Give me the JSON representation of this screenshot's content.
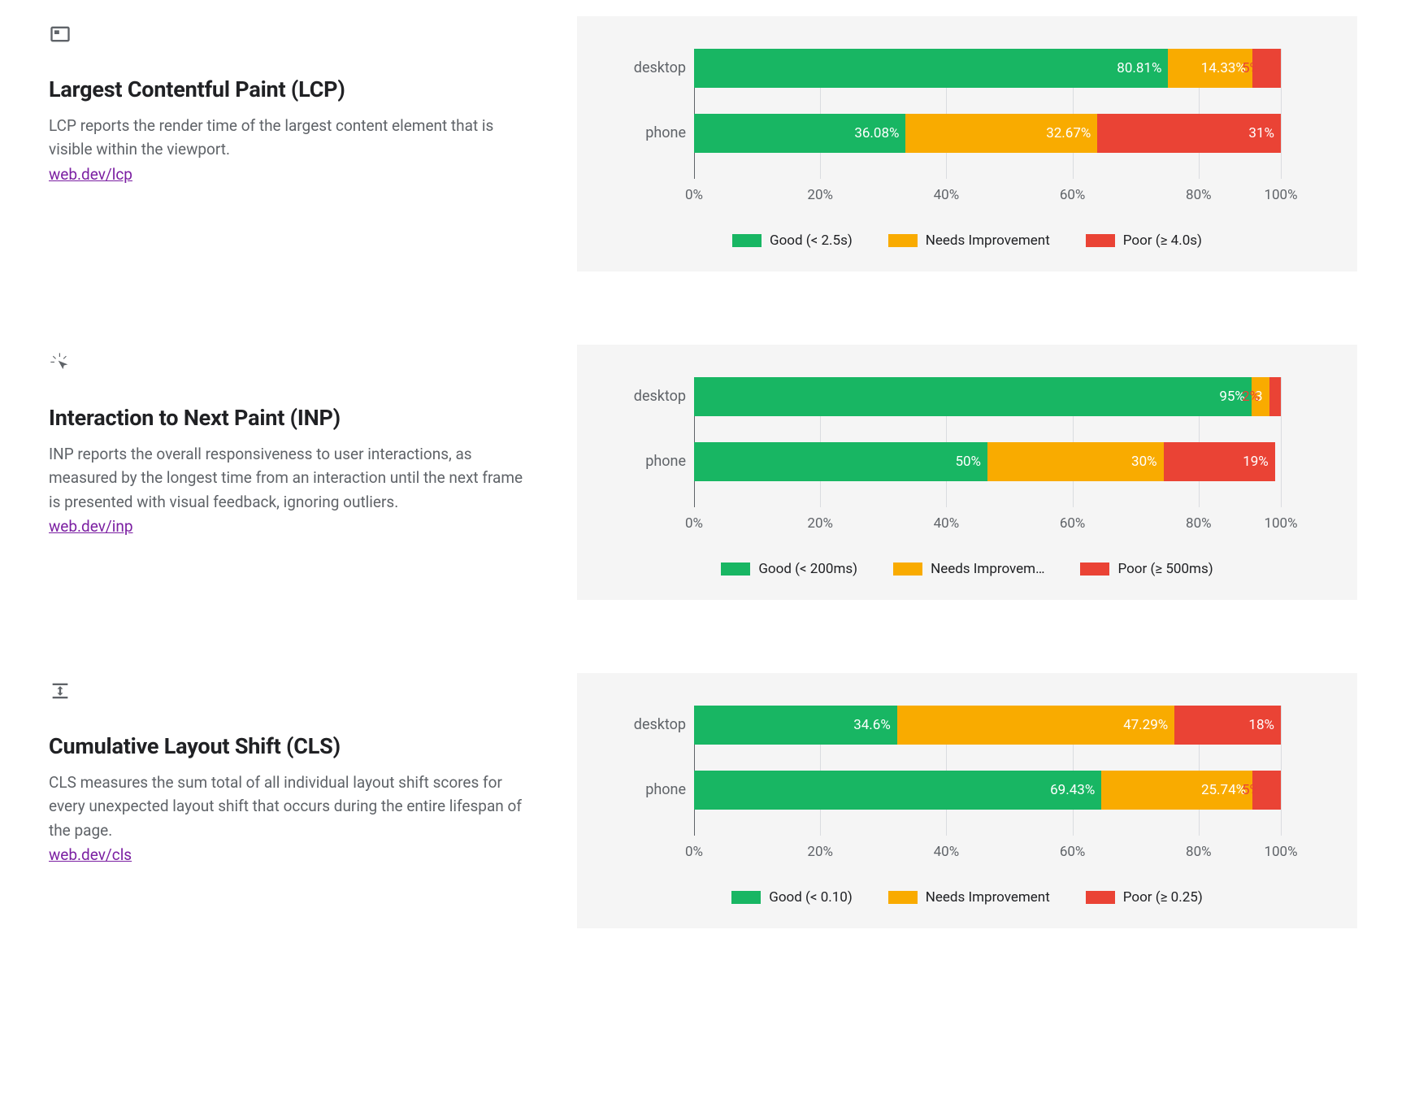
{
  "colors": {
    "good": "#18b663",
    "mid": "#f9ab00",
    "poor": "#ea4335"
  },
  "metrics": [
    {
      "key": "lcp",
      "title": "Largest Contentful Paint (LCP)",
      "desc": "LCP reports the render time of the largest content element that is visible within the viewport.",
      "link": "web.dev/lcp",
      "legend": {
        "good": "Good (< 2.5s)",
        "mid": "Needs Improvement",
        "poor": "Poor (≥ 4.0s)"
      },
      "rows": [
        {
          "label": "desktop",
          "good": {
            "value": 80.81,
            "text": "80.81%"
          },
          "mid": {
            "value": 14.33,
            "text": "14.33%"
          },
          "poor": {
            "value": 4.86,
            "text": ""
          },
          "trailing": "5%"
        },
        {
          "label": "phone",
          "good": {
            "value": 36.08,
            "text": "36.08%"
          },
          "mid": {
            "value": 32.67,
            "text": "32.67%"
          },
          "poor": {
            "value": 31.25,
            "text": "31%"
          },
          "trailing": ""
        }
      ]
    },
    {
      "key": "inp",
      "title": "Interaction to Next Paint (INP)",
      "desc": "INP reports the overall responsiveness to user interactions, as measured by the longest time from an interaction until the next frame is presented with visual feedback, ignoring outliers.",
      "link": "web.dev/inp",
      "legend": {
        "good": "Good (< 200ms)",
        "mid": "Needs Improvem…",
        "poor": "Poor (≥ 500ms)"
      },
      "rows": [
        {
          "label": "desktop",
          "good": {
            "value": 95.0,
            "text": "95%"
          },
          "mid": {
            "value": 3.0,
            "text": "3"
          },
          "poor": {
            "value": 2.0,
            "text": ""
          },
          "trailing": "2%"
        },
        {
          "label": "phone",
          "good": {
            "value": 50.0,
            "text": "50%"
          },
          "mid": {
            "value": 30.0,
            "text": "30%"
          },
          "poor": {
            "value": 19.0,
            "text": "19%"
          },
          "trailing": ""
        }
      ]
    },
    {
      "key": "cls",
      "title": "Cumulative Layout Shift (CLS)",
      "desc": "CLS measures the sum total of all individual layout shift scores for every unexpected layout shift that occurs during the entire lifespan of the page.",
      "link": "web.dev/cls",
      "legend": {
        "good": "Good (< 0.10)",
        "mid": "Needs Improvement",
        "poor": "Poor (≥ 0.25)"
      },
      "rows": [
        {
          "label": "desktop",
          "good": {
            "value": 34.6,
            "text": "34.6%"
          },
          "mid": {
            "value": 47.29,
            "text": "47.29%"
          },
          "poor": {
            "value": 18.11,
            "text": "18%"
          },
          "trailing": ""
        },
        {
          "label": "phone",
          "good": {
            "value": 69.43,
            "text": "69.43%"
          },
          "mid": {
            "value": 25.74,
            "text": "25.74%"
          },
          "poor": {
            "value": 4.83,
            "text": ""
          },
          "trailing": "5%"
        }
      ]
    }
  ],
  "ticks": [
    "0%",
    "20%",
    "40%",
    "60%",
    "80%",
    "100%"
  ],
  "chart_data": [
    {
      "type": "bar",
      "title": "Largest Contentful Paint (LCP)",
      "orientation": "horizontal-stacked",
      "xlabel": "",
      "ylabel": "",
      "xlim": [
        0,
        100
      ],
      "categories": [
        "desktop",
        "phone"
      ],
      "series": [
        {
          "name": "Good (< 2.5s)",
          "values": [
            80.81,
            36.08
          ]
        },
        {
          "name": "Needs Improvement",
          "values": [
            14.33,
            32.67
          ]
        },
        {
          "name": "Poor (≥ 4.0s)",
          "values": [
            4.86,
            31.25
          ]
        }
      ],
      "annotations": {
        "poor_outside_labels": [
          "5%",
          ""
        ]
      }
    },
    {
      "type": "bar",
      "title": "Interaction to Next Paint (INP)",
      "orientation": "horizontal-stacked",
      "xlabel": "",
      "ylabel": "",
      "xlim": [
        0,
        100
      ],
      "categories": [
        "desktop",
        "phone"
      ],
      "series": [
        {
          "name": "Good (< 200ms)",
          "values": [
            95,
            50
          ]
        },
        {
          "name": "Needs Improvement",
          "values": [
            3,
            30
          ]
        },
        {
          "name": "Poor (≥ 500ms)",
          "values": [
            2,
            19
          ]
        }
      ],
      "annotations": {
        "poor_outside_labels": [
          "2%",
          ""
        ]
      }
    },
    {
      "type": "bar",
      "title": "Cumulative Layout Shift (CLS)",
      "orientation": "horizontal-stacked",
      "xlabel": "",
      "ylabel": "",
      "xlim": [
        0,
        100
      ],
      "categories": [
        "desktop",
        "phone"
      ],
      "series": [
        {
          "name": "Good (< 0.10)",
          "values": [
            34.6,
            69.43
          ]
        },
        {
          "name": "Needs Improvement",
          "values": [
            47.29,
            25.74
          ]
        },
        {
          "name": "Poor (≥ 0.25)",
          "values": [
            18.11,
            4.83
          ]
        }
      ],
      "annotations": {
        "poor_outside_labels": [
          "",
          "5%"
        ]
      }
    }
  ]
}
